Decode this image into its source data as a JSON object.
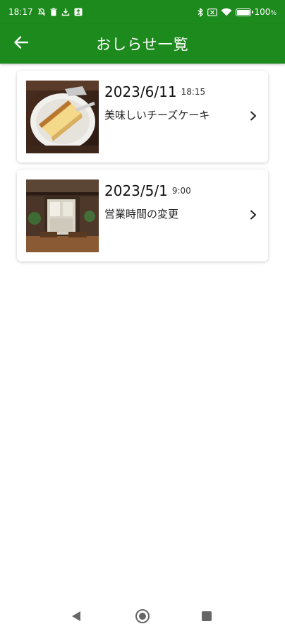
{
  "status_bar": {
    "time": "18:17",
    "battery": "100",
    "battery_level": 1.0,
    "icons": [
      "notification-muted-icon",
      "trash-icon",
      "download-icon",
      "app-badge-icon",
      "bluetooth-icon",
      "no-sim-icon",
      "wifi-icon",
      "battery-icon"
    ]
  },
  "app_bar": {
    "title": "おしらせ一覧",
    "back_icon": "arrow-left-icon"
  },
  "news": [
    {
      "date": "2023/6/11",
      "time": "18:15",
      "title": "美味しいチーズケーキ",
      "thumbnail": "cheesecake-image"
    },
    {
      "date": "2023/5/1",
      "time": "9:00",
      "title": "営業時間の変更",
      "thumbnail": "cafe-interior-image"
    }
  ],
  "colors": {
    "primary": "#1d8a1d",
    "card_bg": "#ffffff",
    "text": "#1a1a1a"
  },
  "nav_bar": {
    "icons": [
      "back-triangle-icon",
      "home-circle-icon",
      "recents-square-icon"
    ]
  }
}
